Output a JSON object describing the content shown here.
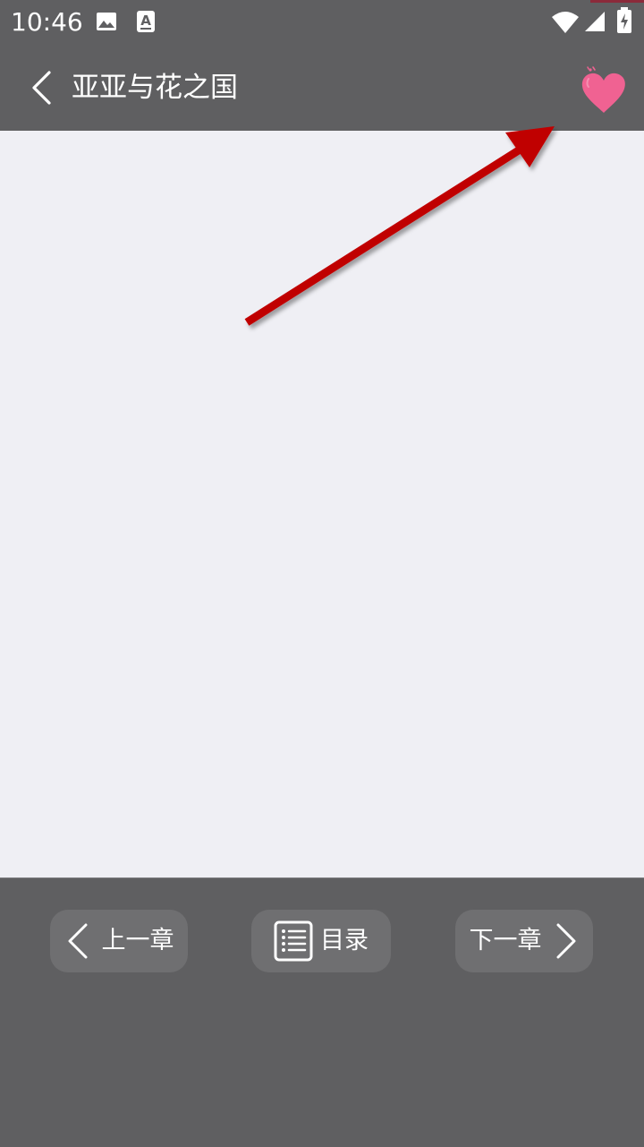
{
  "status_bar": {
    "time": "10:46",
    "icons": [
      "image-icon",
      "text-a-icon",
      "wifi-icon",
      "signal-icon",
      "battery-charging-icon"
    ]
  },
  "app_bar": {
    "title": "亚亚与花之国",
    "back_icon": "chevron-left-icon",
    "favorite_icon": "heart-icon"
  },
  "toolbar": {
    "prev_label": "上一章",
    "toc_label": "目录",
    "next_label": "下一章"
  },
  "colors": {
    "bar_background": "#5f5f61",
    "content_background": "#efeff4",
    "button_background": "#6f6f71",
    "heart": "#f06292",
    "annotation_arrow": "#c00000"
  }
}
